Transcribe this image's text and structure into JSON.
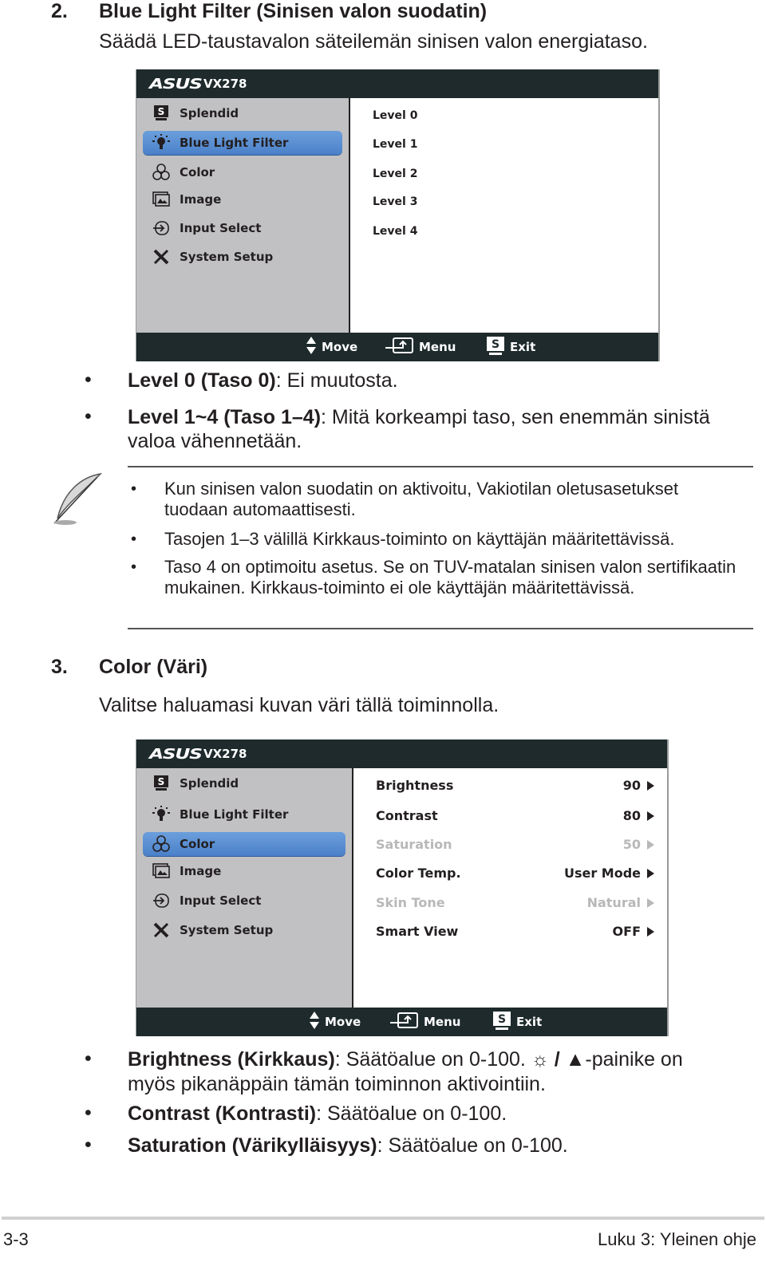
{
  "section2": {
    "number": "2.",
    "title": "Blue Light Filter (Sinisen valon suodatin)",
    "description": "Säädä LED-taustavalon säteilemän sinisen valon energiataso."
  },
  "osd1": {
    "brand": "ASUS",
    "model": "VX278",
    "menu": [
      {
        "icon": "splendid-icon",
        "label": "Splendid"
      },
      {
        "icon": "bulb-icon",
        "label": "Blue Light Filter",
        "active": true
      },
      {
        "icon": "rgb-icon",
        "label": "Color"
      },
      {
        "icon": "image-icon",
        "label": "Image"
      },
      {
        "icon": "input-icon",
        "label": "Input Select"
      },
      {
        "icon": "tools-icon",
        "label": "System Setup"
      }
    ],
    "options": [
      "Level 0",
      "Level 1",
      "Level 2",
      "Level 3",
      "Level 4"
    ],
    "footer": {
      "move": "Move",
      "menu": "Menu",
      "exit": "Exit",
      "exit_key": "S"
    }
  },
  "level_bullets": [
    {
      "bold": "Level 0 (Taso 0)",
      "text": ": Ei muutosta."
    },
    {
      "bold": "Level 1~4 (Taso 1–4)",
      "text": ": Mitä korkeampi taso, sen enemmän sinistä valoa vähennetään."
    }
  ],
  "note": {
    "icon": "feather-pen-icon",
    "items": [
      "Kun sinisen valon suodatin on aktivoitu, Vakiotilan oletusasetukset tuodaan automaattisesti.",
      "Tasojen 1–3 välillä Kirkkaus-toiminto on käyttäjän määritettävissä.",
      "Taso 4 on optimoitu asetus. Se on TUV-matalan sinisen valon sertifikaatin mukainen. Kirkkaus-toiminto ei ole käyttäjän määritettävissä."
    ]
  },
  "section3": {
    "number": "3.",
    "title": "Color (Väri)",
    "description": "Valitse haluamasi kuvan väri tällä toiminnolla."
  },
  "osd2": {
    "brand": "ASUS",
    "model": "VX278",
    "menu": [
      {
        "icon": "splendid-icon",
        "label": "Splendid"
      },
      {
        "icon": "bulb-icon",
        "label": "Blue Light Filter"
      },
      {
        "icon": "rgb-icon",
        "label": "Color",
        "active": true
      },
      {
        "icon": "image-icon",
        "label": "Image"
      },
      {
        "icon": "input-icon",
        "label": "Input Select"
      },
      {
        "icon": "tools-icon",
        "label": "System Setup"
      }
    ],
    "settings": [
      {
        "label": "Brightness",
        "value": "90",
        "enabled": true
      },
      {
        "label": "Contrast",
        "value": "80",
        "enabled": true
      },
      {
        "label": "Saturation",
        "value": "50",
        "enabled": false
      },
      {
        "label": "Color Temp.",
        "value": "User Mode",
        "enabled": true
      },
      {
        "label": "Skin Tone",
        "value": "Natural",
        "enabled": false
      },
      {
        "label": "Smart View",
        "value": "OFF",
        "enabled": true
      }
    ],
    "footer": {
      "move": "Move",
      "menu": "Menu",
      "exit": "Exit",
      "exit_key": "S"
    }
  },
  "color_bullets": [
    {
      "bold": "Brightness (Kirkkaus)",
      "text_before": ": Säätöalue on 0-100. ",
      "hotkey_icons": [
        "sun-icon",
        "up-triangle-icon"
      ],
      "text_after": "-painike on myös pikanäppäin tämän toiminnon aktivointiin."
    },
    {
      "bold": "Contrast (Kontrasti)",
      "text": ": Säätöalue on 0-100."
    },
    {
      "bold": "Saturation (Värikylläisyys)",
      "text": ": Säätöalue on 0-100."
    }
  ],
  "footer": {
    "page": "3-3",
    "chapter": "Luku 3: Yleinen ohje"
  }
}
